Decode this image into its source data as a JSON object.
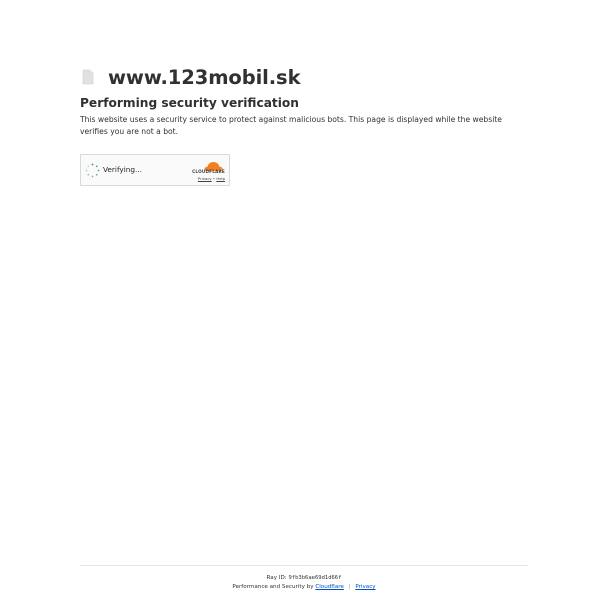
{
  "site": {
    "name": "www.123mobil.sk",
    "favicon_icon": "page-icon"
  },
  "main": {
    "headline": "Performing security verification",
    "description": "This website uses a security service to protect against malicious bots. This page is displayed while the website verifies you are not a bot."
  },
  "widget": {
    "status_text": "Verifying...",
    "spinner_icon": "spinner-icon",
    "brand_icon": "cloudflare-cloud-icon",
    "brand_label": "CLOUDFLARE",
    "privacy_label": "Privacy",
    "separator": "•",
    "help_label": "Help",
    "brand_color": "#f38020"
  },
  "footer": {
    "ray_label": "Ray ID:",
    "ray_id": "9fb3b6ae69d1d66f",
    "perf_label": "Performance and Security by",
    "cloudflare_link": "Cloudflare",
    "divider": "|",
    "privacy_link": "Privacy",
    "link_color": "#0051c3"
  }
}
